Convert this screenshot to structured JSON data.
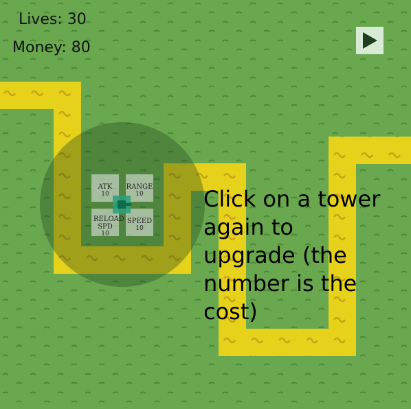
{
  "hud": {
    "lives": "Lives: 30",
    "money": "Money: 80"
  },
  "controls": {
    "play_icon": "play-icon"
  },
  "upgrades": [
    {
      "label": "ATK",
      "cost": "10"
    },
    {
      "label": "RANGE",
      "cost": "10"
    },
    {
      "label": "RELOAD SPD",
      "cost": "10"
    },
    {
      "label": "SPEED",
      "cost": "10"
    }
  ],
  "tutorial": {
    "text": "Click on a tower again to upgrade (the number is the cost)"
  },
  "colors": {
    "grass": "#6aa84f",
    "path": "#e6d21a",
    "range": "#2e5a2a",
    "tower": "#1e8f6a"
  }
}
